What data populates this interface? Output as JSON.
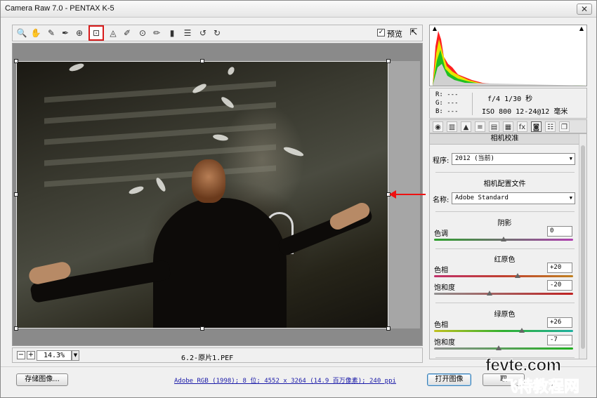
{
  "window": {
    "title": "Camera Raw 7.0 -  PENTAX K-5",
    "close": "✕"
  },
  "toolbar": {
    "tools": [
      {
        "name": "zoom-tool",
        "glyph": "🔍"
      },
      {
        "name": "hand-tool",
        "glyph": "✋"
      },
      {
        "name": "white-balance-tool",
        "glyph": "✎"
      },
      {
        "name": "color-sampler-tool",
        "glyph": "✒"
      },
      {
        "name": "target-adjustment-tool",
        "glyph": "⊕"
      },
      {
        "name": "crop-tool",
        "glyph": "⊡"
      },
      {
        "name": "straighten-tool",
        "glyph": "◬"
      },
      {
        "name": "spot-removal-tool",
        "glyph": "✐"
      },
      {
        "name": "red-eye-tool",
        "glyph": "⊙"
      },
      {
        "name": "adjustment-brush-tool",
        "glyph": "✏"
      },
      {
        "name": "graduated-filter-tool",
        "glyph": "▮"
      },
      {
        "name": "preferences-tool",
        "glyph": "☰"
      },
      {
        "name": "rotate-ccw-tool",
        "glyph": "↺"
      },
      {
        "name": "rotate-cw-tool",
        "glyph": "↻"
      }
    ],
    "preview_label": "预览",
    "preview_checked": "✓",
    "fullscreen_icon": "⇱"
  },
  "status": {
    "zoom_out": "−",
    "zoom_in": "+",
    "zoom": "14.3%",
    "zoom_arrow": "▼",
    "filename": "6.2-原片1.PEF"
  },
  "histogram": {
    "clip_shadow": "▲",
    "clip_highlight": "▲"
  },
  "info": {
    "r": "R:  ---",
    "g": "G:  ---",
    "b": "B:  ---",
    "exposure": "f/4   1/30 秒",
    "iso_lens": "ISO 800   12-24@12 毫米"
  },
  "panel_tabs": [
    {
      "name": "tab-basic",
      "glyph": "◉"
    },
    {
      "name": "tab-tone-curve",
      "glyph": "▥"
    },
    {
      "name": "tab-detail",
      "glyph": "▲"
    },
    {
      "name": "tab-hsl",
      "glyph": "≡"
    },
    {
      "name": "tab-split-toning",
      "glyph": "▤"
    },
    {
      "name": "tab-lens-corrections",
      "glyph": "▦"
    },
    {
      "name": "tab-effects",
      "glyph": "fx"
    },
    {
      "name": "tab-camera-calibration",
      "glyph": "◙"
    },
    {
      "name": "tab-presets",
      "glyph": "☷"
    },
    {
      "name": "tab-snapshots",
      "glyph": "❐"
    }
  ],
  "panel": {
    "title": "相机校准",
    "process_label": "程序:",
    "process_value": "2012 (当前)",
    "profile_header": "相机配置文件",
    "name_label": "名称:",
    "name_value": "Adobe Standard",
    "shadows_header": "阴影",
    "tint_label": "色调",
    "tint_value": "0",
    "red_header": "红原色",
    "red_hue_label": "色相",
    "red_hue_value": "+20",
    "red_sat_label": "饱和度",
    "red_sat_value": "-20",
    "green_header": "绿原色",
    "green_hue_label": "色相",
    "green_hue_value": "+26",
    "green_sat_label": "饱和度",
    "green_sat_value": "-7",
    "dropdown_arrow": "▼",
    "slider_levels": {
      "tint": 0,
      "red_hue": 20,
      "red_sat": -20,
      "green_hue": 26,
      "green_sat": -7
    }
  },
  "bottom": {
    "save": "存储图像...",
    "workflow": "Adobe RGB (1998); 8 位; 4552 x 3264 (14.9 百万像素); 240 ppi",
    "open": "打开图像",
    "cancel": "取"
  },
  "watermark": {
    "line1": "fevte.com",
    "line2": "飞特教程网"
  },
  "colors": {
    "annotation_red": "#e11111",
    "link_blue": "#1a1aa8"
  }
}
